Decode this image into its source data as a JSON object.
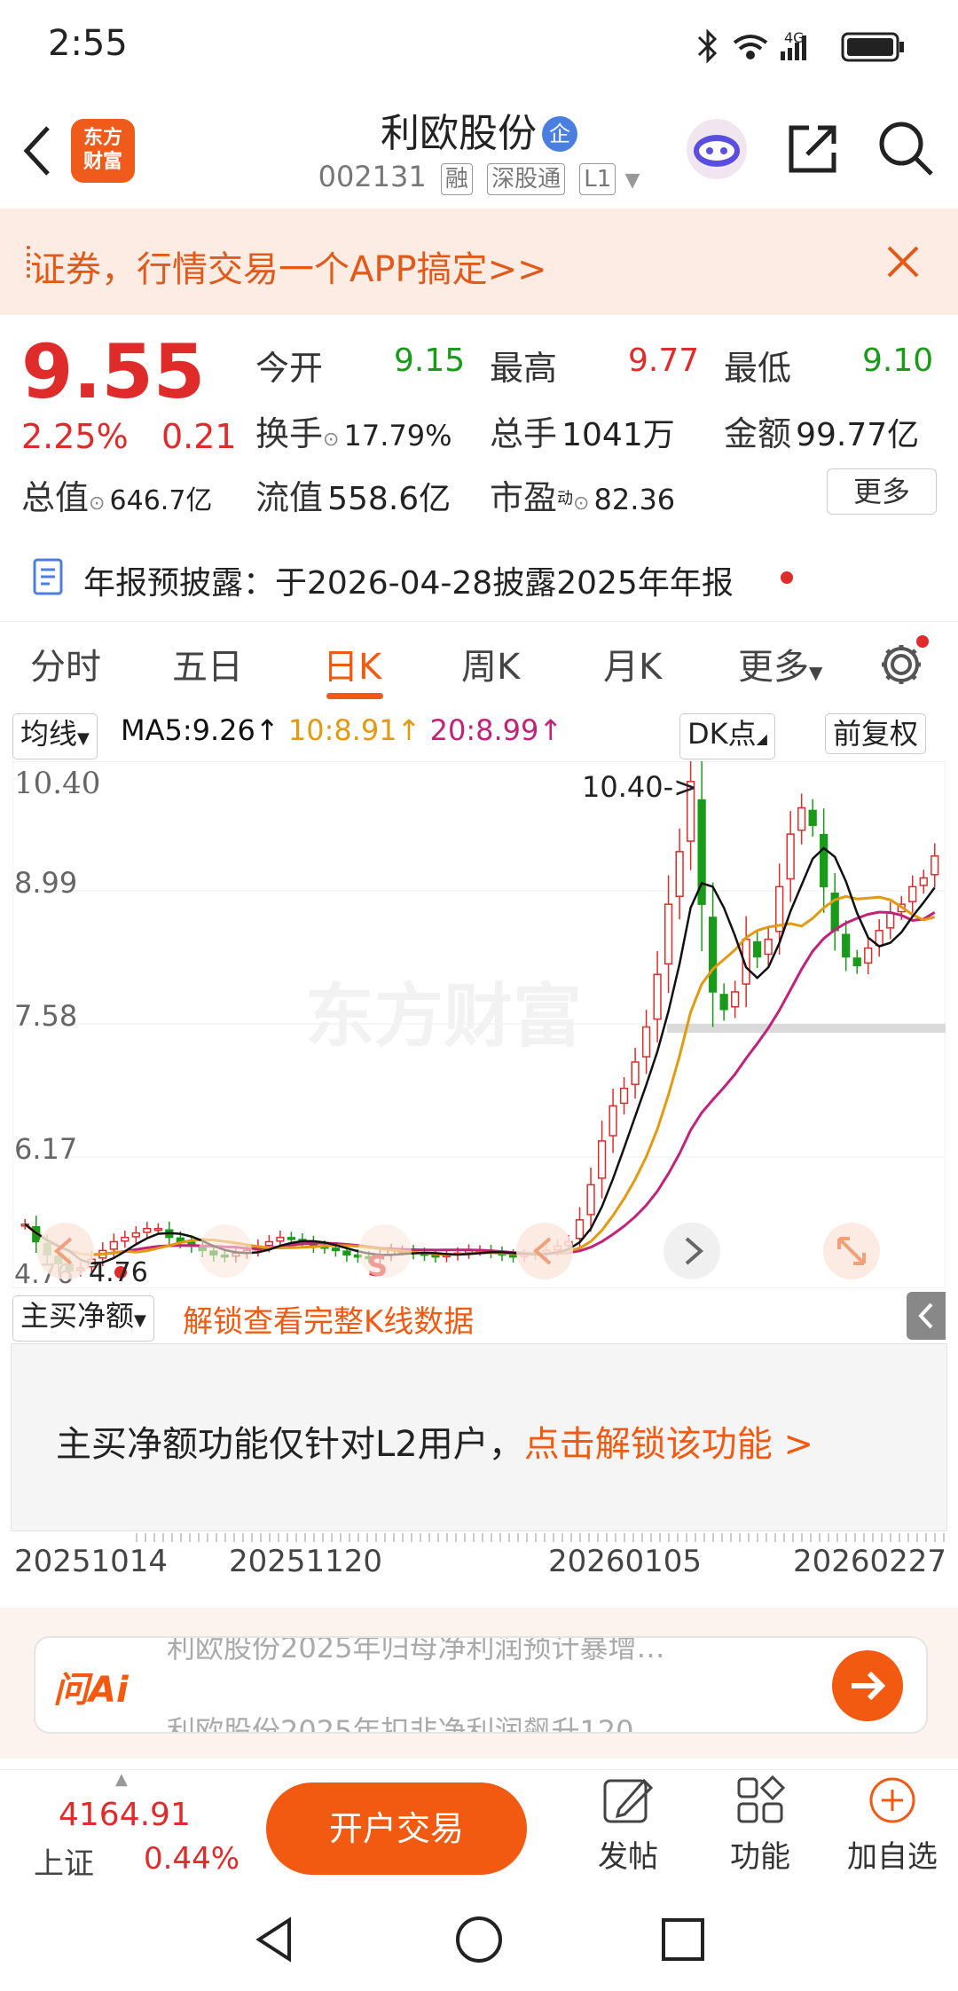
{
  "status": {
    "time": "2:55",
    "network": "4G"
  },
  "header": {
    "logo_text": "东方\n财富",
    "title": "利欧股份",
    "title_badge": "企",
    "code": "002131",
    "tags": [
      "融",
      "深股通",
      "L1"
    ]
  },
  "banner": {
    "text": "证券，行情交易一个APP搞定>>"
  },
  "quote": {
    "price": "9.55",
    "change_pct": "2.25%",
    "change": "0.21",
    "market_cap_label": "总值",
    "market_cap": "646.7亿",
    "open_label": "今开",
    "open": "9.15",
    "high_label": "最高",
    "high": "9.77",
    "low_label": "最低",
    "low": "9.10",
    "turnover_label": "换手",
    "turnover": "17.79%",
    "volume_label": "总手",
    "volume": "1041万",
    "amount_label": "金额",
    "amount": "99.77亿",
    "float_cap_label": "流值",
    "float_cap": "558.6亿",
    "pe_label": "市盈",
    "pe_sup": "动",
    "pe": "82.36",
    "more_label": "更多"
  },
  "notice": {
    "text": "年报预披露：于2026-04-28披露2025年年报"
  },
  "tabs": [
    "分时",
    "五日",
    "日K",
    "周K",
    "月K",
    "更多"
  ],
  "active_tab": "日K",
  "chart_controls": {
    "ma_select": "均线",
    "ma5": "MA5:9.26",
    "ma10": "10:8.91",
    "ma20": "20:8.99",
    "dk_label": "DK点",
    "adjust_label": "前复权"
  },
  "colors": {
    "up": "#e02b2b",
    "down": "#1a9a1a",
    "brand": "#f25a12",
    "ma5": "#111111",
    "ma10": "#e39a12",
    "ma20": "#c0237a"
  },
  "chart_data": {
    "type": "candlestick",
    "y_ticks": [
      "10.40",
      "8.99",
      "7.58",
      "6.17"
    ],
    "y_bottom_label": "4.76",
    "max_label": "10.40->",
    "min_label": "4.76",
    "watermark": "东方财富",
    "x_labels": [
      "20251014",
      "20251120",
      "20260105",
      "20260227"
    ],
    "closes": [
      5.35,
      5.15,
      5.0,
      4.9,
      4.82,
      4.85,
      4.95,
      5.05,
      5.15,
      5.2,
      5.25,
      5.3,
      5.3,
      5.2,
      5.15,
      5.1,
      5.05,
      5.0,
      4.98,
      5.02,
      5.05,
      5.1,
      5.15,
      5.2,
      5.18,
      5.15,
      5.1,
      5.08,
      5.05,
      5.0,
      4.98,
      4.97,
      5.0,
      5.05,
      5.05,
      5.02,
      5.0,
      4.98,
      5.0,
      5.02,
      5.05,
      5.05,
      5.03,
      5.0,
      4.98,
      5.0,
      5.02,
      5.05,
      5.1,
      5.15,
      5.4,
      5.8,
      6.3,
      6.7,
      6.9,
      7.2,
      7.6,
      8.2,
      9.0,
      9.6,
      10.4,
      9.0,
      8.0,
      7.8,
      8.0,
      8.6,
      8.4,
      8.6,
      9.2,
      9.8,
      10.1,
      9.9,
      9.2,
      8.7,
      8.4,
      8.3,
      8.5,
      8.7,
      8.9,
      9.0,
      9.2,
      9.3,
      9.55
    ]
  },
  "sub_chart": {
    "select_label": "主买净额",
    "unlock_link": "解锁查看完整K线数据",
    "message": "主买净额功能仅针对L2用户，",
    "message_link": "点击解锁该功能 >"
  },
  "ai": {
    "logo": "问Ai",
    "line1": "利欧股份2025年归母净利润预计暴增…",
    "line2": "利欧股份2025年扣非净利润飙升120…"
  },
  "bottom": {
    "index_value": "4164.91",
    "index_name": "上证",
    "index_change": "0.44%",
    "trade_button": "开户交易",
    "post_label": "发帖",
    "func_label": "功能",
    "watch_label": "加自选"
  }
}
